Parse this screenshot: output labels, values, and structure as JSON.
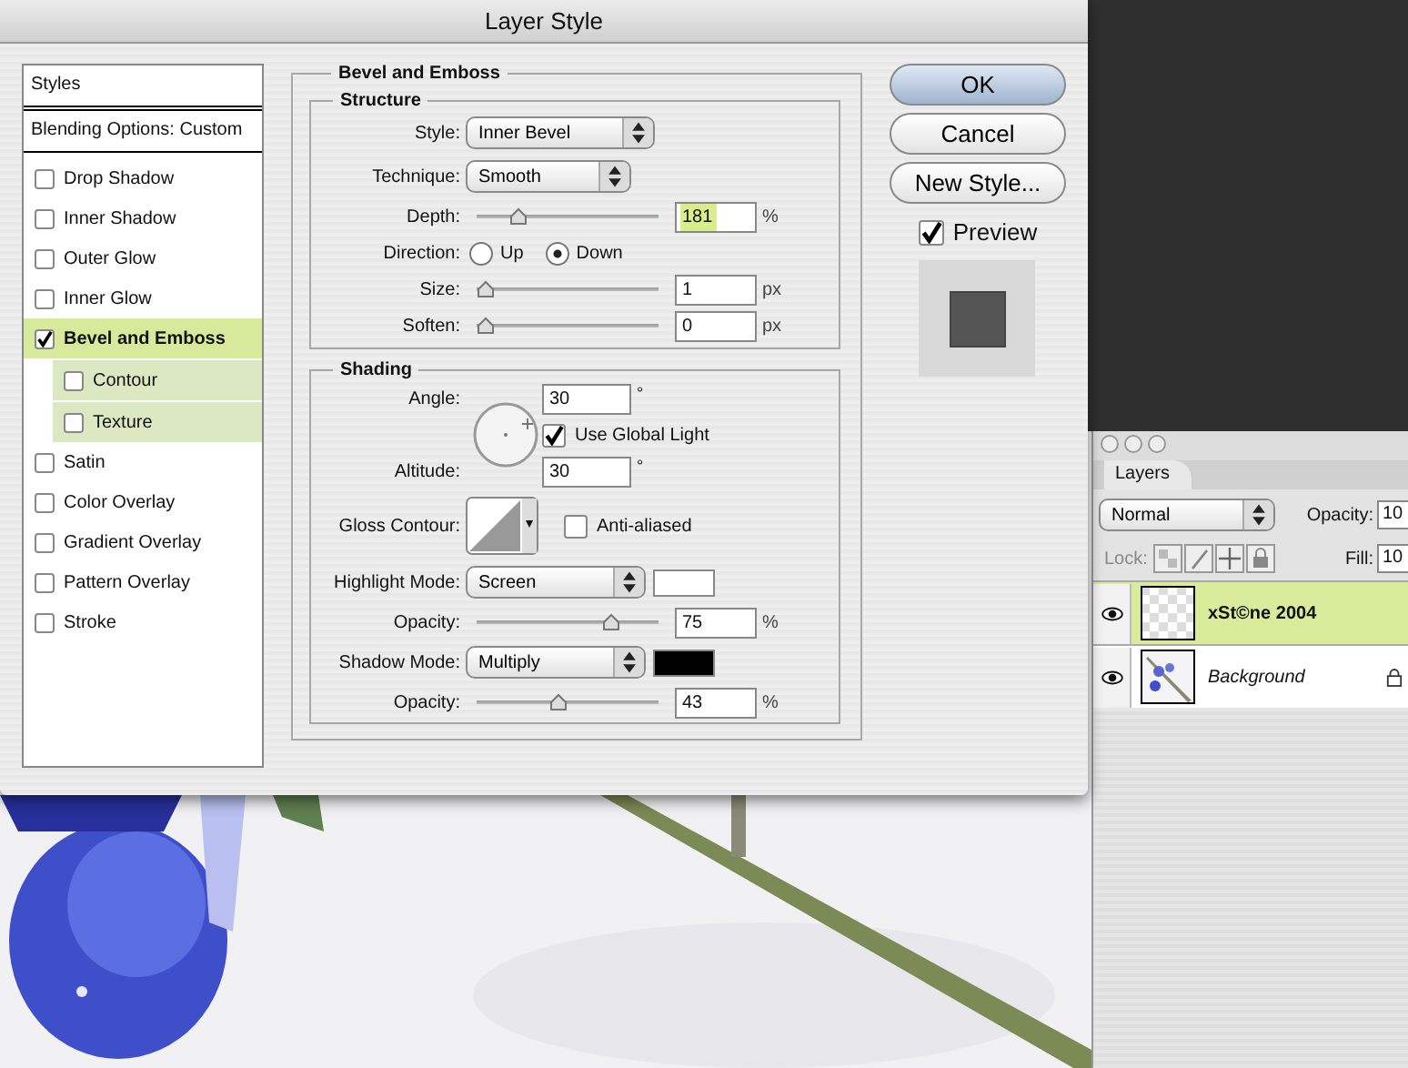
{
  "window": {
    "title": "Layer Style"
  },
  "styles_list": {
    "header": "Styles",
    "blending": "Blending Options: Custom",
    "items": [
      {
        "label": "Drop Shadow",
        "checked": false,
        "selected": false
      },
      {
        "label": "Inner Shadow",
        "checked": false,
        "selected": false
      },
      {
        "label": "Outer Glow",
        "checked": false,
        "selected": false
      },
      {
        "label": "Inner Glow",
        "checked": false,
        "selected": false
      },
      {
        "label": "Bevel and Emboss",
        "checked": true,
        "selected": true,
        "children": [
          {
            "label": "Contour",
            "checked": false,
            "selected": false
          },
          {
            "label": "Texture",
            "checked": false,
            "selected": false
          }
        ]
      },
      {
        "label": "Satin",
        "checked": false,
        "selected": false
      },
      {
        "label": "Color Overlay",
        "checked": false,
        "selected": false
      },
      {
        "label": "Gradient Overlay",
        "checked": false,
        "selected": false
      },
      {
        "label": "Pattern Overlay",
        "checked": false,
        "selected": false
      },
      {
        "label": "Stroke",
        "checked": false,
        "selected": false
      }
    ]
  },
  "panel": {
    "title": "Bevel and Emboss",
    "structure": {
      "title": "Structure",
      "rows": [
        {
          "kind": "select",
          "label": "Style:",
          "value": "Inner Bevel"
        },
        {
          "kind": "select",
          "label": "Technique:",
          "value": "Smooth"
        },
        {
          "kind": "slider",
          "label": "Depth:",
          "level": 0.2,
          "value": "181",
          "unit": "%",
          "highlighted": true
        },
        {
          "kind": "radio",
          "label": "Direction:",
          "options": [
            {
              "label": "Up",
              "selected": false
            },
            {
              "label": "Down",
              "selected": true
            }
          ]
        },
        {
          "kind": "slider",
          "label": "Size:",
          "level": 0,
          "value": "1",
          "unit": "px",
          "highlighted": false
        },
        {
          "kind": "slider",
          "label": "Soften:",
          "level": 0,
          "value": "0",
          "unit": "px",
          "highlighted": false
        }
      ]
    },
    "shading": {
      "title": "Shading",
      "angle": {
        "label": "Angle:",
        "value": "30",
        "unit": "°"
      },
      "global_light": {
        "label": "Use Global Light",
        "checked": true
      },
      "altitude": {
        "label": "Altitude:",
        "value": "30",
        "unit": "°"
      },
      "gloss_contour": {
        "label": "Gloss Contour:"
      },
      "anti_aliased": {
        "label": "Anti-aliased",
        "checked": false
      },
      "rows": [
        {
          "kind": "select",
          "label": "Highlight Mode:",
          "value": "Screen",
          "color": "#ffffff"
        },
        {
          "kind": "slider",
          "label": "Opacity:",
          "level": 0.75,
          "value": "75",
          "unit": "%",
          "highlighted": false
        },
        {
          "kind": "select",
          "label": "Shadow Mode:",
          "value": "Multiply",
          "color": "#000000"
        },
        {
          "kind": "slider",
          "label": "Opacity:",
          "level": 0.43,
          "value": "43",
          "unit": "%",
          "highlighted": false
        }
      ]
    }
  },
  "buttons": [
    {
      "label": "OK",
      "default": true
    },
    {
      "label": "Cancel",
      "default": false
    },
    {
      "label": "New Style...",
      "default": false
    }
  ],
  "preview": {
    "label": "Preview",
    "checked": true
  },
  "layers_panel": {
    "tab": "Layers",
    "blend_mode": "Normal",
    "opacity_label": "Opacity:",
    "opacity": "10",
    "lock_label": "Lock:",
    "fill_label": "Fill:",
    "fill": "10",
    "layers": [
      {
        "name": "xSt©ne 2004",
        "kind": "transparent",
        "selected": true,
        "visible": true,
        "locked": false
      },
      {
        "name": "Background",
        "kind": "picture",
        "selected": false,
        "visible": true,
        "locked": true
      }
    ]
  }
}
